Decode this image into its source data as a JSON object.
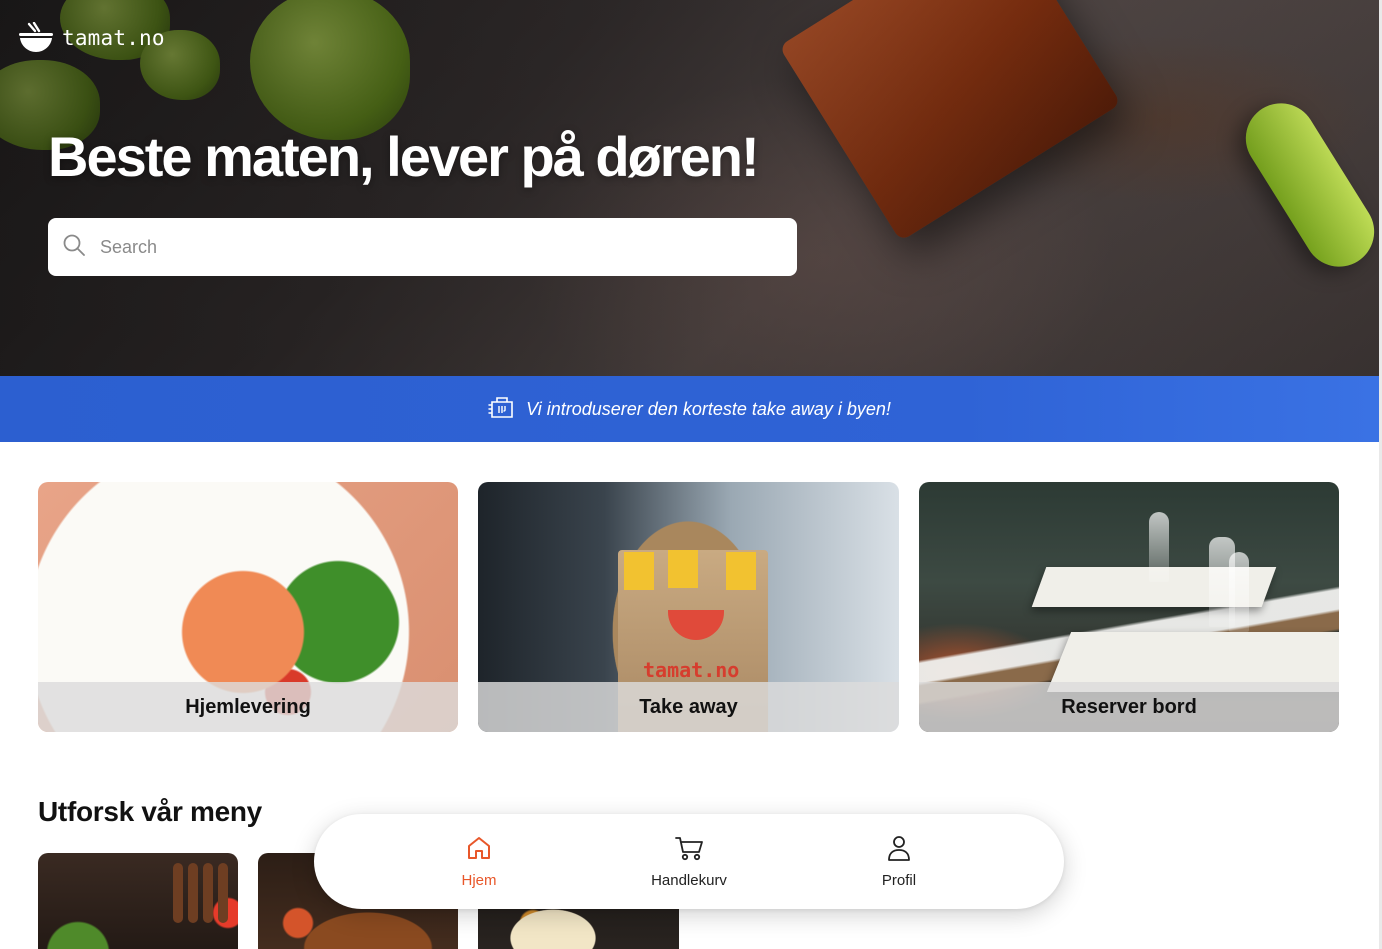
{
  "brand": {
    "name": "tamat.no",
    "icon": "bowl-icon"
  },
  "hero": {
    "headline": "Beste maten, lever på døren!",
    "search": {
      "placeholder": "Search",
      "value": "",
      "icon": "search-icon"
    }
  },
  "banner": {
    "icon": "takeaway-bag-icon",
    "text": "Vi introduserer den korteste take away i byen!"
  },
  "services": [
    {
      "label": "Hjemlevering",
      "image": "noodle-soup-photo"
    },
    {
      "label": "Take away",
      "image": "takeaway-bag-photo",
      "bag_text": "tamat.no"
    },
    {
      "label": "Reserver bord",
      "image": "restaurant-tables-photo"
    }
  ],
  "menu_section": {
    "title": "Utforsk vår meny",
    "items": [
      {
        "image": "dish-photo-1"
      },
      {
        "image": "dish-photo-2"
      },
      {
        "image": "dessert-photo-3"
      }
    ]
  },
  "bottom_nav": {
    "items": [
      {
        "label": "Hjem",
        "icon": "home-icon",
        "active": true
      },
      {
        "label": "Handlekurv",
        "icon": "cart-icon",
        "active": false
      },
      {
        "label": "Profil",
        "icon": "user-icon",
        "active": false
      }
    ]
  },
  "colors": {
    "accent": "#e8572a",
    "banner": "#2f63d6",
    "text_dark": "#111111",
    "white": "#ffffff"
  }
}
